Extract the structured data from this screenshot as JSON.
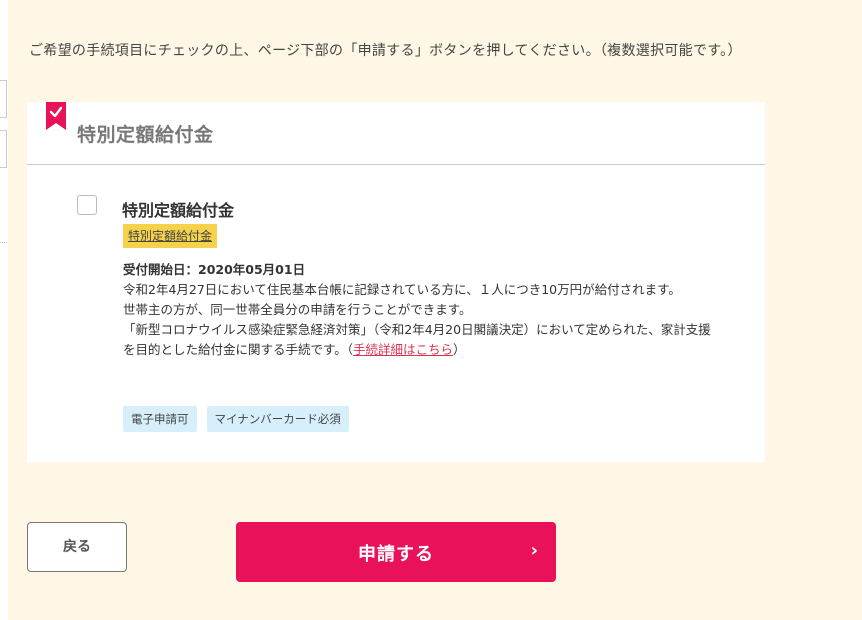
{
  "instruction": "ご希望の手続項目にチェックの上、ページ下部の「申請する」ボタンを押してください。（複数選択可能です。）",
  "card": {
    "title": "特別定額給付金",
    "bookmark_color": "#e8115a",
    "item": {
      "title": "特別定額給付金",
      "category_tag": "特別定額給付金",
      "start_date": "受付開始日：2020年05月01日",
      "desc_line1": "令和2年4月27日において住民基本台帳に記録されている方に、１人につき10万円が給付されます。",
      "desc_line2": "世帯主の方が、同一世帯全員分の申請を行うことができます。",
      "desc_line3": "「新型コロナウイルス感染症緊急経済対策」（令和2年4月20日閣議決定）において定められた、家計支援を目的とした給付金に関する手続です。",
      "link_open": "（",
      "link_text": "手続詳細はこちら",
      "link_close": "）",
      "tags": [
        "電子申請可",
        "マイナンバーカード必須"
      ]
    }
  },
  "buttons": {
    "back_label": "戻る",
    "apply_label": "申請する",
    "apply_icon": "chevron-right-icon"
  },
  "colors": {
    "background": "#fff7e6",
    "primary": "#e8115a",
    "category_tag": "#f5d24a",
    "feature_tag": "#d6effa",
    "link": "#d9324f"
  }
}
